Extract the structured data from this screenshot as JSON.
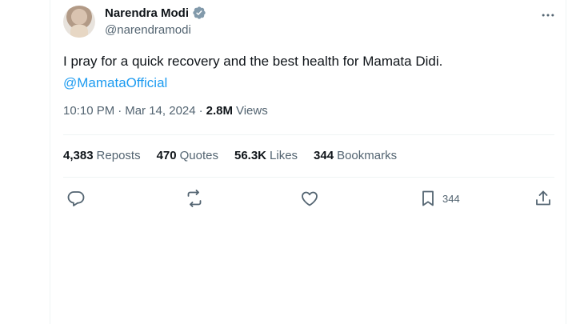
{
  "tweet": {
    "author": {
      "display_name": "Narendra Modi",
      "handle": "@narendramodi"
    },
    "text": "I pray for a quick recovery and the best health for Mamata Didi.",
    "mention": "@MamataOfficial",
    "time": "10:10 PM",
    "separator": "·",
    "date": "Mar 14, 2024",
    "views_count": "2.8M",
    "views_label": "Views"
  },
  "stats": {
    "reposts_count": "4,383",
    "reposts_label": "Reposts",
    "quotes_count": "470",
    "quotes_label": "Quotes",
    "likes_count": "56.3K",
    "likes_label": "Likes",
    "bookmarks_count": "344",
    "bookmarks_label": "Bookmarks"
  },
  "actions": {
    "bookmark_count": "344"
  },
  "icons": [
    "verified-badge-icon",
    "more-options-icon",
    "reply-icon",
    "repost-icon",
    "like-icon",
    "bookmark-icon",
    "share-icon"
  ],
  "colors": {
    "text_primary": "#0f1419",
    "text_secondary": "#536471",
    "link": "#1d9bf0",
    "border": "#eff3f4",
    "verified_badge": "#829aab"
  }
}
